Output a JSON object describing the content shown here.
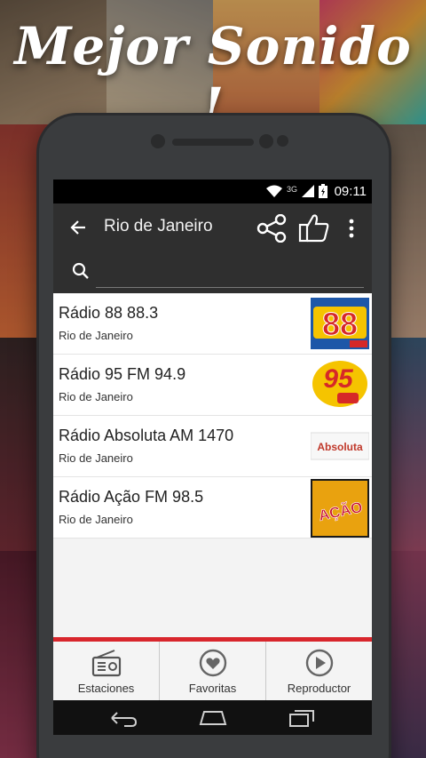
{
  "headline": "Mejor Sonido !",
  "status_bar": {
    "network": "3G",
    "time": "09:11"
  },
  "app_bar": {
    "title": "Rio de Janeiro"
  },
  "search": {
    "value": "",
    "placeholder": ""
  },
  "stations": [
    {
      "name": "Rádio 88 88.3",
      "city": "Rio de Janeiro",
      "logo_text": "88"
    },
    {
      "name": "Rádio 95 FM 94.9",
      "city": "Rio de Janeiro",
      "logo_text": "95"
    },
    {
      "name": "Rádio Absoluta AM 1470",
      "city": "Rio de Janeiro",
      "logo_text": "Absoluta"
    },
    {
      "name": "Rádio Ação FM 98.5",
      "city": "Rio de Janeiro",
      "logo_text": "AÇÃO"
    }
  ],
  "tabs": [
    {
      "label": "Estaciones",
      "icon": "radio-icon"
    },
    {
      "label": "Favoritas",
      "icon": "heart-icon"
    },
    {
      "label": "Reproductor",
      "icon": "play-icon"
    }
  ],
  "colors": {
    "accent_red": "#d8262c",
    "app_bar": "#2f2f2f",
    "logo_yellow": "#f5c400",
    "logo_red": "#d62828"
  }
}
